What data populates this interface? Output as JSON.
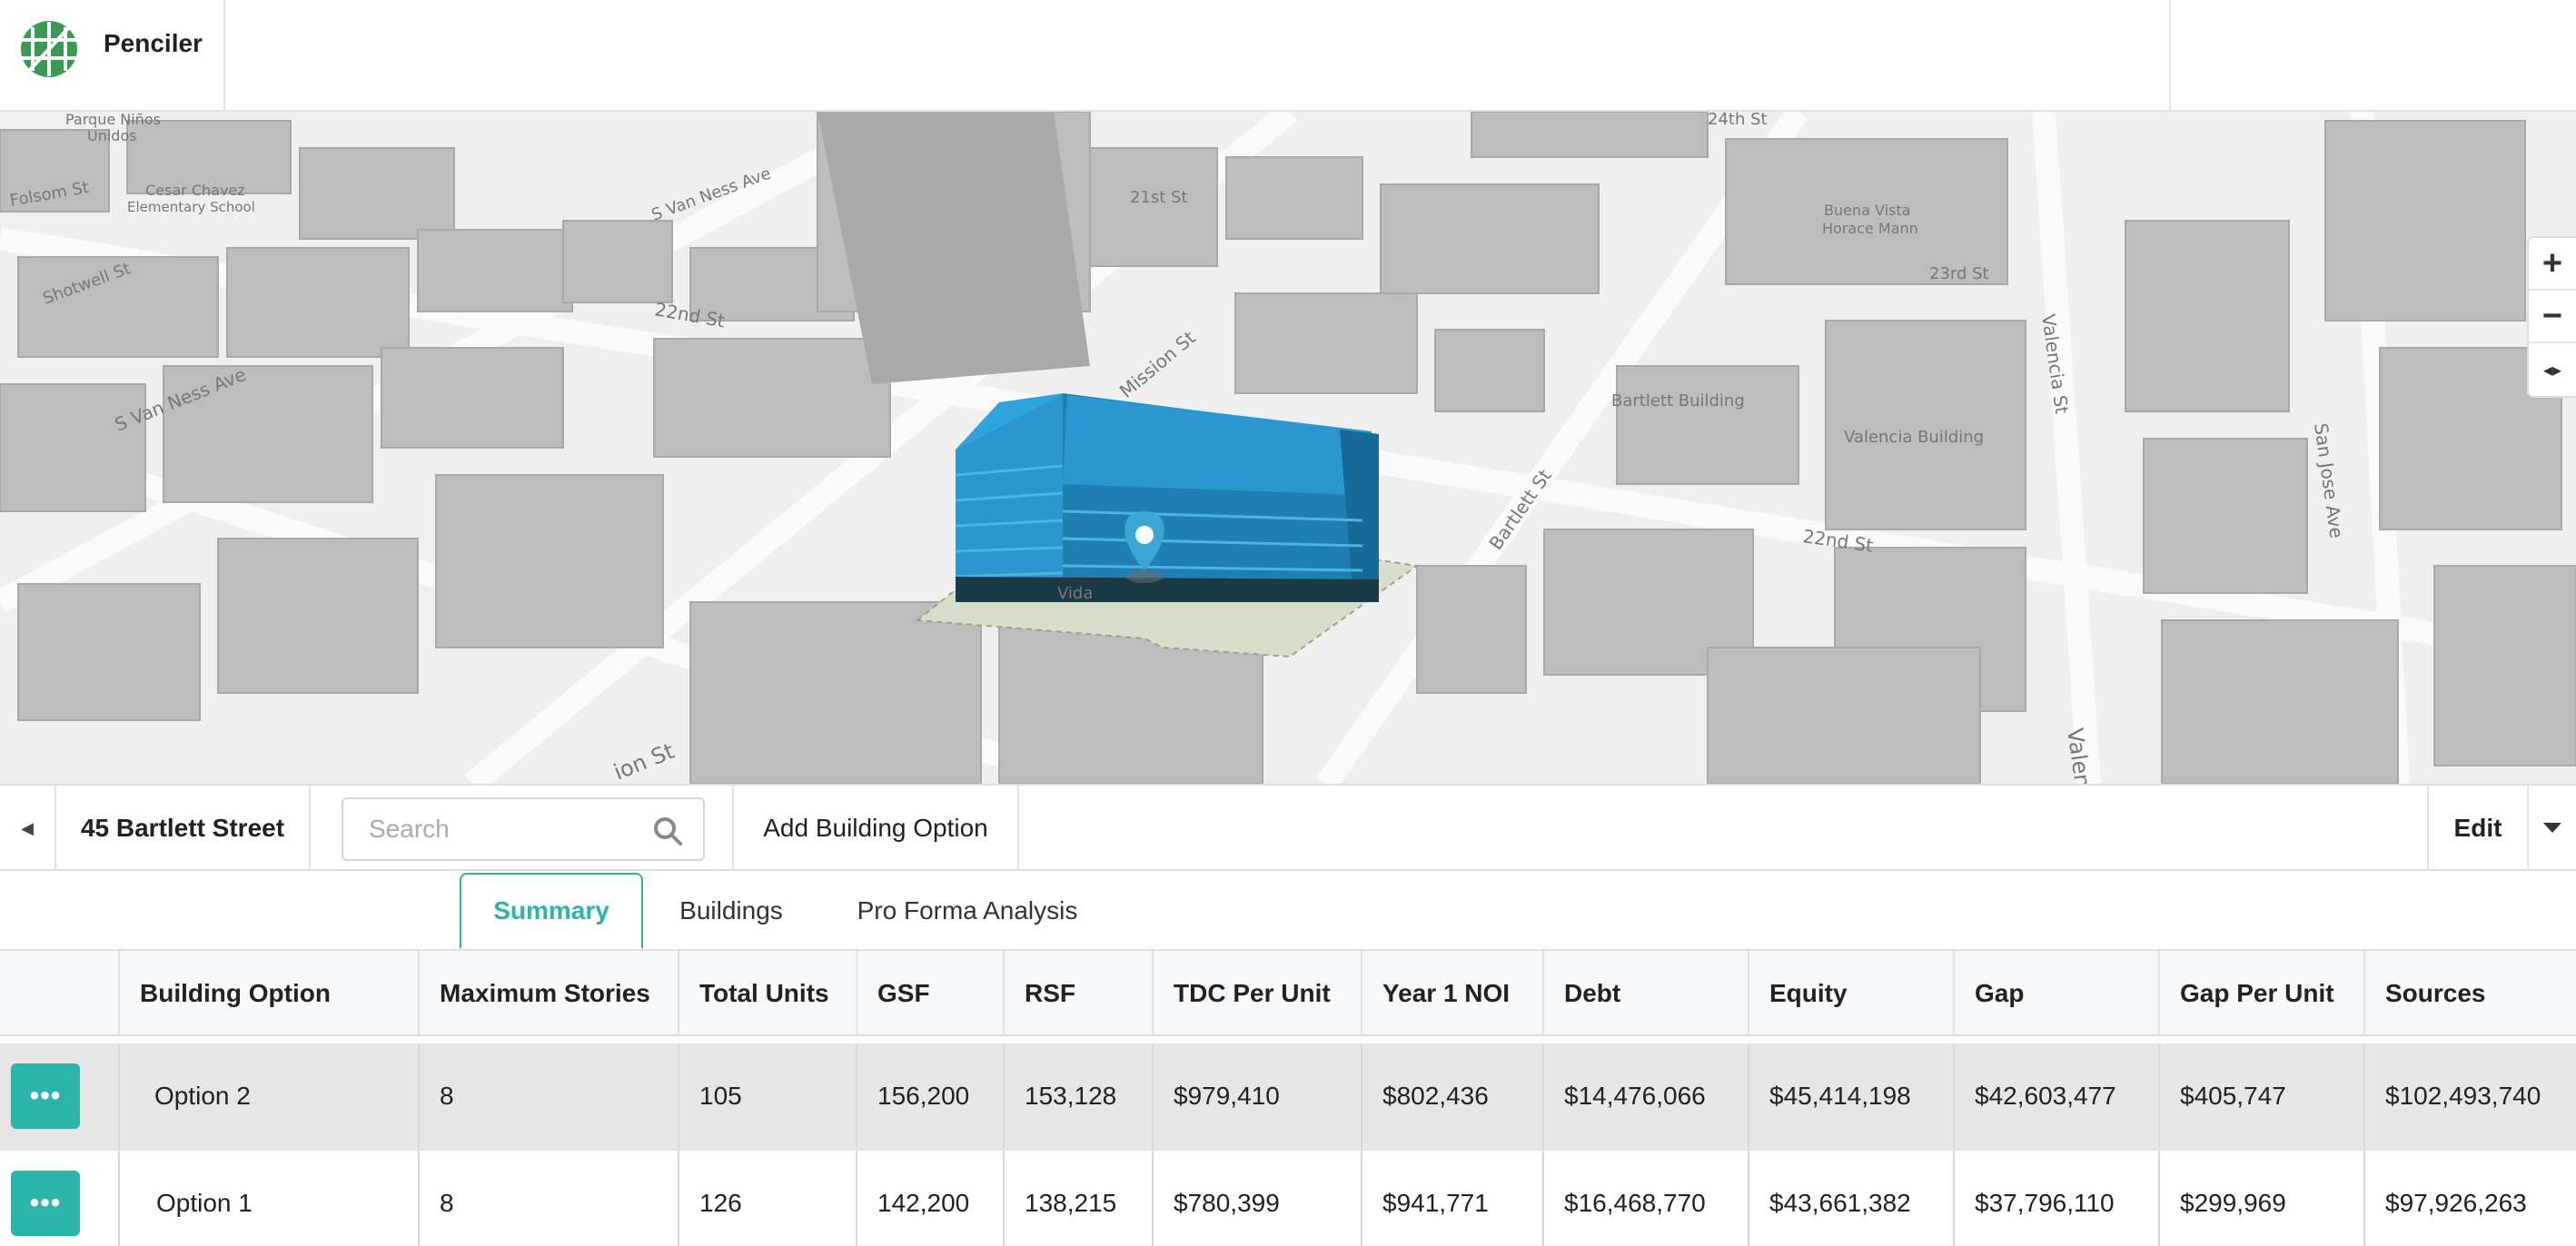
{
  "app": {
    "name": "Penciler"
  },
  "map": {
    "street_labels": [
      "Folsom St",
      "Shotwell St",
      "S Van Ness Ave",
      "22nd St",
      "Mission St",
      "Bartlett St",
      "Valencia St",
      "San Jose Ave",
      "22nd St",
      "23rd St",
      "24th St",
      "21st St",
      "S Van Ness Ave",
      "Valen"
    ],
    "place_labels": [
      "Parque Niños Unidos",
      "Cesar Chavez Elementary School",
      "Buena Vista Horace Mann",
      "Bartlett Building",
      "Valencia Building",
      "Vida"
    ],
    "building_color": "#2a98cf",
    "zoom_in_label": "+",
    "zoom_out_label": "−",
    "compass_label": "◂▸"
  },
  "toolbar": {
    "back_icon": "caret-left-icon",
    "project_title": "45 Bartlett Street",
    "search_placeholder": "Search",
    "add_building_option": "Add Building Option",
    "edit_label": "Edit",
    "caret_icon": "caret-down-icon"
  },
  "tabs": [
    {
      "label": "Summary",
      "active": true
    },
    {
      "label": "Buildings",
      "active": false
    },
    {
      "label": "Pro Forma Analysis",
      "active": false
    }
  ],
  "table": {
    "columns": [
      "Building Option",
      "Maximum Stories",
      "Total Units",
      "GSF",
      "RSF",
      "TDC Per Unit",
      "Year 1 NOI",
      "Debt",
      "Equity",
      "Gap",
      "Gap Per Unit",
      "Sources"
    ],
    "rows": [
      [
        "Option 2",
        "8",
        "105",
        "156,200",
        "153,128",
        "$979,410",
        "$802,436",
        "$14,476,066",
        "$45,414,198",
        "$42,603,477",
        "$405,747",
        "$102,493,740"
      ],
      [
        "Option 1",
        "8",
        "126",
        "142,200",
        "138,215",
        "$780,399",
        "$941,771",
        "$16,468,770",
        "$43,661,382",
        "$37,796,110",
        "$299,969",
        "$97,926,263"
      ]
    ],
    "row_action_label": "•••"
  },
  "colors": {
    "accent": "#2bb4a8",
    "logo_green": "#3a9a55"
  }
}
